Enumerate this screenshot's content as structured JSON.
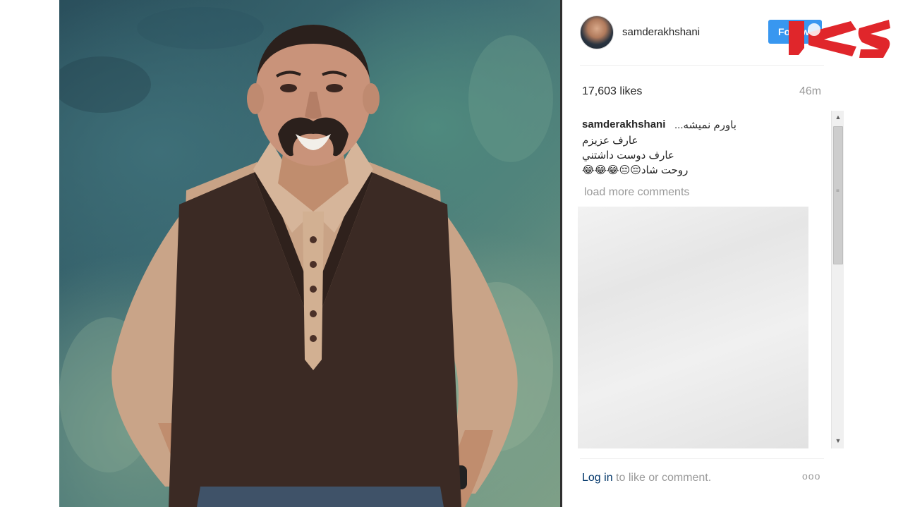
{
  "post": {
    "username": "samderakhshani",
    "follow_label": "Follow",
    "likes": "17,603 likes",
    "time": "46m",
    "caption": {
      "user": "samderakhshani",
      "lines": [
        "باورم نميشه...",
        "عارف عزيزم",
        "عارف دوست داشتني",
        "روحت شاد😔😔😂😂😂"
      ]
    },
    "load_more": "load more comments",
    "login": {
      "link": "Log in",
      "rest": " to like or comment."
    },
    "more": "ooo"
  },
  "icons": {
    "more": "more-options-icon",
    "scroll_up": "scroll-up-icon",
    "scroll_down": "scroll-down-icon"
  },
  "colors": {
    "follow_button": "#3897f0",
    "logo_red": "#e0262b",
    "login_link": "#003569",
    "muted_text": "#999999"
  }
}
